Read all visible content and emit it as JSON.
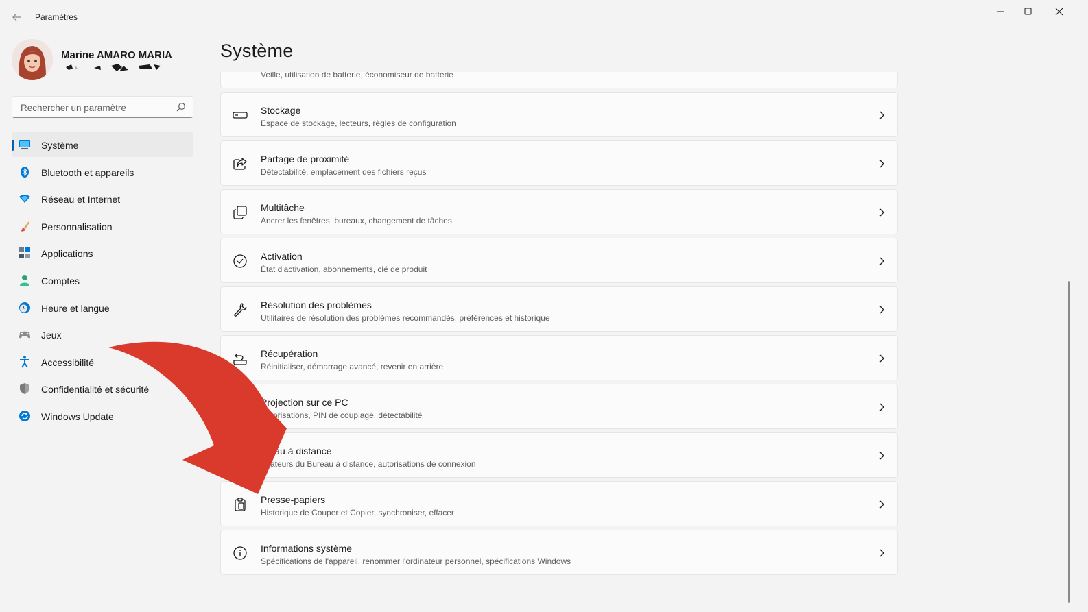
{
  "window": {
    "title": "Paramètres"
  },
  "profile": {
    "name": "Marine AMARO MARIA"
  },
  "search": {
    "placeholder": "Rechercher un paramètre"
  },
  "sidebar": {
    "items": [
      {
        "label": "Système",
        "icon": "system-icon",
        "active": true
      },
      {
        "label": "Bluetooth et appareils",
        "icon": "bluetooth-icon",
        "active": false
      },
      {
        "label": "Réseau et Internet",
        "icon": "wifi-icon",
        "active": false
      },
      {
        "label": "Personnalisation",
        "icon": "brush-icon",
        "active": false
      },
      {
        "label": "Applications",
        "icon": "apps-icon",
        "active": false
      },
      {
        "label": "Comptes",
        "icon": "account-icon",
        "active": false
      },
      {
        "label": "Heure et langue",
        "icon": "clock-globe-icon",
        "active": false
      },
      {
        "label": "Jeux",
        "icon": "gamepad-icon",
        "active": false
      },
      {
        "label": "Accessibilité",
        "icon": "accessibility-icon",
        "active": false
      },
      {
        "label": "Confidentialité et sécurité",
        "icon": "shield-icon",
        "active": false
      },
      {
        "label": "Windows Update",
        "icon": "update-icon",
        "active": false
      }
    ]
  },
  "main": {
    "title": "Système",
    "cards": [
      {
        "title": "",
        "subtitle": "Veille, utilisation de batterie, économiseur de batterie",
        "icon": "power-icon"
      },
      {
        "title": "Stockage",
        "subtitle": "Espace de stockage, lecteurs, règles de configuration",
        "icon": "storage-icon"
      },
      {
        "title": "Partage de proximité",
        "subtitle": "Détectabilité, emplacement des fichiers reçus",
        "icon": "share-icon"
      },
      {
        "title": "Multitâche",
        "subtitle": "Ancrer les fenêtres, bureaux, changement de tâches",
        "icon": "multitask-icon"
      },
      {
        "title": "Activation",
        "subtitle": "État d'activation, abonnements, clé de produit",
        "icon": "check-circle-icon"
      },
      {
        "title": "Résolution des problèmes",
        "subtitle": "Utilitaires de résolution des problèmes recommandés, préférences et historique",
        "icon": "wrench-icon"
      },
      {
        "title": "Récupération",
        "subtitle": "Réinitialiser, démarrage avancé, revenir en arrière",
        "icon": "recovery-icon"
      },
      {
        "title": "Projection sur ce PC",
        "subtitle": "Autorisations, PIN de couplage, détectabilité",
        "icon": "projection-icon"
      },
      {
        "title": "ureau à distance",
        "subtitle": "ilisateurs du Bureau à distance, autorisations de connexion",
        "icon": "remote-desktop-icon"
      },
      {
        "title": "Presse-papiers",
        "subtitle": "Historique de Couper et Copier, synchroniser, effacer",
        "icon": "clipboard-icon"
      },
      {
        "title": "Informations système",
        "subtitle": "Spécifications de l'appareil, renommer l'ordinateur personnel, spécifications Windows",
        "icon": "info-icon"
      }
    ]
  },
  "colors": {
    "accent": "#005fb8",
    "overlay_arrow": "#d93a2b",
    "background": "#f3f3f3",
    "card": "#fbfbfb"
  }
}
